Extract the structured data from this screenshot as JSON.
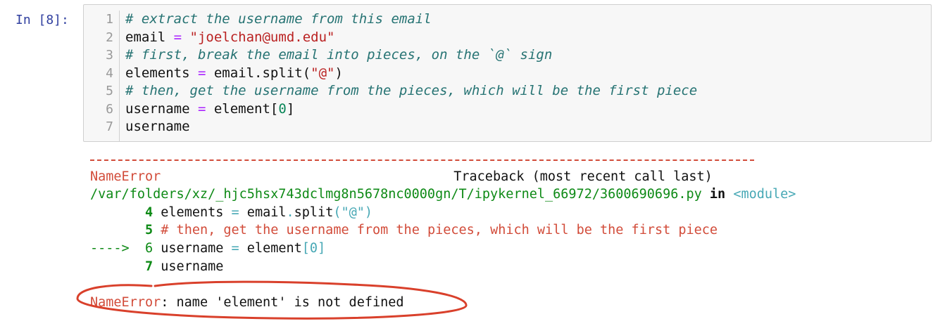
{
  "cell": {
    "prompt": "In [8]:",
    "line_numbers": [
      "1",
      "2",
      "3",
      "4",
      "5",
      "6",
      "7"
    ],
    "lines": [
      {
        "tokens": [
          {
            "text": "# extract the username from this email",
            "cls": "cm"
          }
        ]
      },
      {
        "tokens": [
          {
            "text": "email ",
            "cls": ""
          },
          {
            "text": "=",
            "cls": "op"
          },
          {
            "text": " ",
            "cls": ""
          },
          {
            "text": "\"joelchan@umd.edu\"",
            "cls": "str"
          }
        ]
      },
      {
        "tokens": [
          {
            "text": "# first, break the email into pieces, on the `@` sign",
            "cls": "cm"
          }
        ]
      },
      {
        "tokens": [
          {
            "text": "elements ",
            "cls": ""
          },
          {
            "text": "=",
            "cls": "op"
          },
          {
            "text": " email.split(",
            "cls": ""
          },
          {
            "text": "\"@\"",
            "cls": "str"
          },
          {
            "text": ")",
            "cls": ""
          }
        ]
      },
      {
        "tokens": [
          {
            "text": "# then, get the username from the pieces, which will be the first piece",
            "cls": "cm"
          }
        ]
      },
      {
        "tokens": [
          {
            "text": "username ",
            "cls": ""
          },
          {
            "text": "=",
            "cls": "op"
          },
          {
            "text": " element[",
            "cls": ""
          },
          {
            "text": "0",
            "cls": "num"
          },
          {
            "text": "]",
            "cls": ""
          }
        ]
      },
      {
        "tokens": [
          {
            "text": "username",
            "cls": ""
          }
        ]
      }
    ]
  },
  "traceback": {
    "error_name": "NameError",
    "traceback_label": "Traceback (most recent call last)",
    "file_path": "/var/folders/xz/_hjc5hsx743dclmg8n5678nc0000gn/T/ipykernel_66972/3600690696.py",
    "in_word": "in",
    "module": "<module>",
    "context_lines": [
      {
        "arrow": "",
        "num": "4",
        "tokens": [
          {
            "text": "elements ",
            "cls": ""
          },
          {
            "text": "=",
            "cls": "teal"
          },
          {
            "text": " email",
            "cls": ""
          },
          {
            "text": ".",
            "cls": "teal"
          },
          {
            "text": "split",
            "cls": ""
          },
          {
            "text": "(",
            "cls": "teal"
          },
          {
            "text": "\"@\"",
            "cls": "teal"
          },
          {
            "text": ")",
            "cls": "teal"
          }
        ]
      },
      {
        "arrow": "",
        "num": "5",
        "tokens": [
          {
            "text": "# then, get the username from the pieces, which will be the first piece",
            "cls": "red"
          }
        ]
      },
      {
        "arrow": "---->",
        "num": "6",
        "tokens": [
          {
            "text": "username ",
            "cls": ""
          },
          {
            "text": "=",
            "cls": "teal"
          },
          {
            "text": " element",
            "cls": ""
          },
          {
            "text": "[",
            "cls": "teal"
          },
          {
            "text": "0",
            "cls": "teal"
          },
          {
            "text": "]",
            "cls": "teal"
          }
        ]
      },
      {
        "arrow": "",
        "num": "7",
        "tokens": [
          {
            "text": "username",
            "cls": ""
          }
        ]
      }
    ],
    "final_error_name": "NameError",
    "final_message": ": name 'element' is not defined"
  },
  "colors": {
    "error_red": "#d24c3a",
    "green": "#0e8a16",
    "teal": "#47a8b5",
    "annotation_red": "#d9402b",
    "prompt_blue": "#303f9f"
  }
}
